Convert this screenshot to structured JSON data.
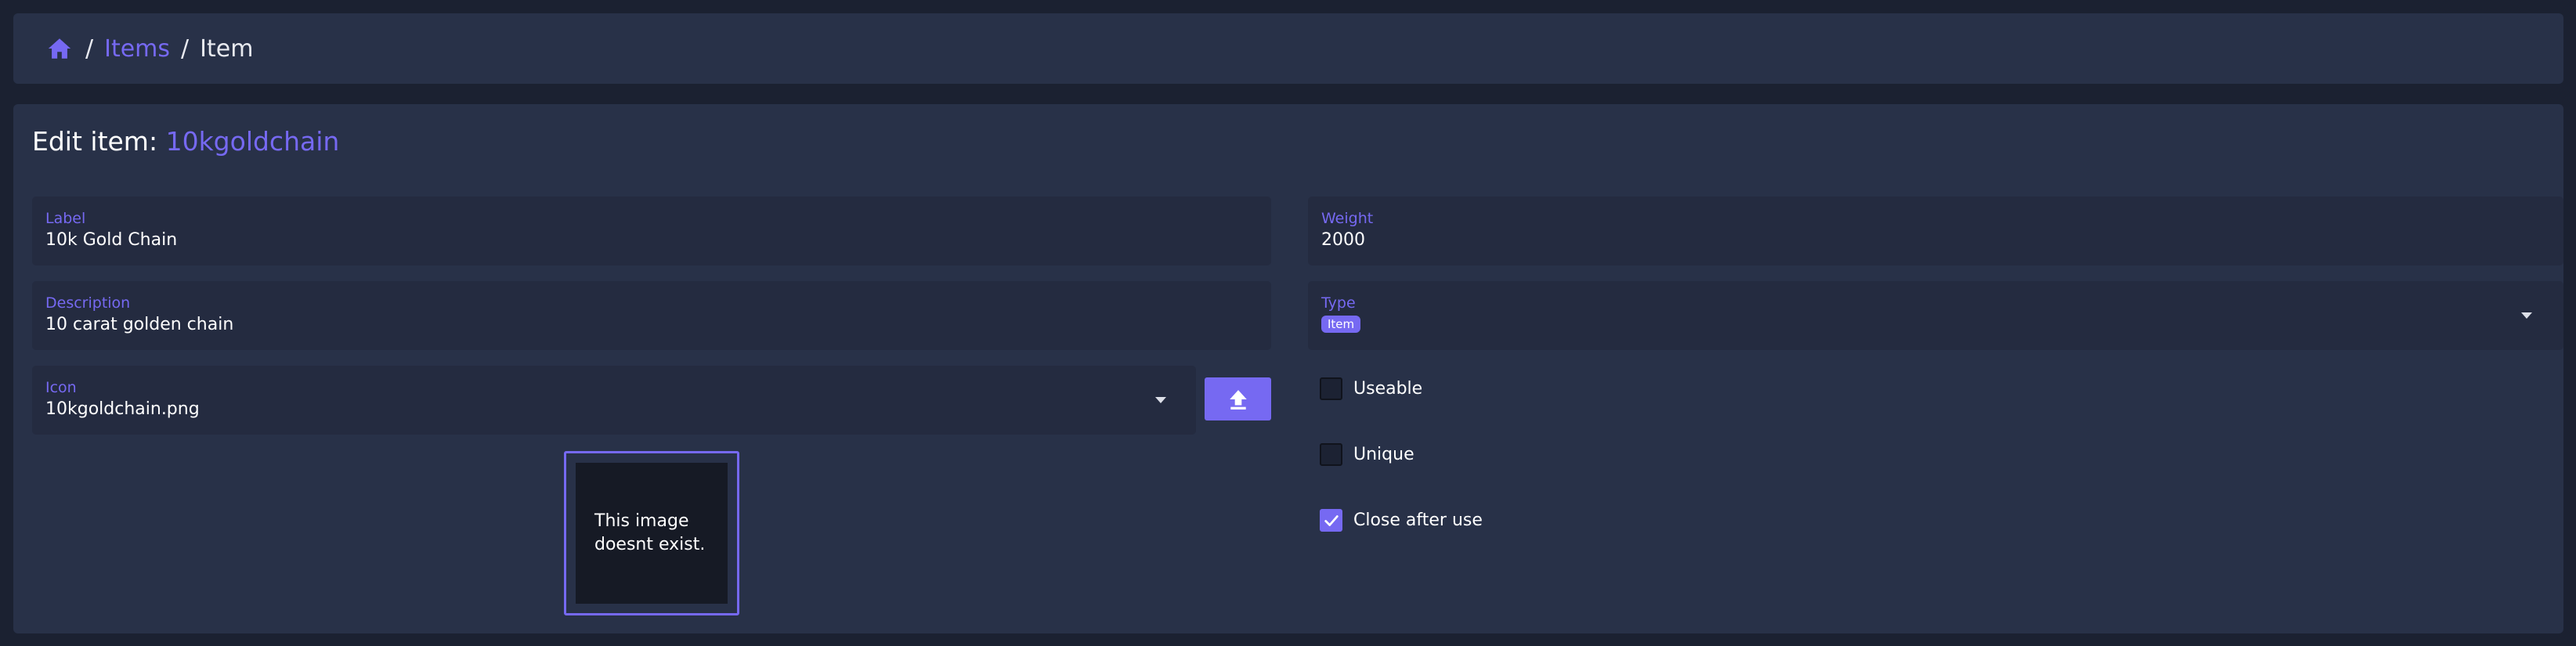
{
  "breadcrumb": {
    "home_icon": "home-icon",
    "separator": "/",
    "items_label": "Items",
    "current_label": "Item"
  },
  "editor": {
    "title_prefix": "Edit item:",
    "item_id": "10kgoldchain"
  },
  "fields": {
    "label": {
      "label": "Label",
      "value": "10k Gold Chain"
    },
    "description": {
      "label": "Description",
      "value": "10 carat golden chain"
    },
    "icon": {
      "label": "Icon",
      "value": "10kgoldchain.png"
    },
    "weight": {
      "label": "Weight",
      "value": "2000"
    },
    "type": {
      "label": "Type",
      "value": "Item"
    }
  },
  "upload_button": {
    "icon": "upload-icon"
  },
  "image_preview": {
    "message": "This image doesnt exist."
  },
  "options": [
    {
      "label": "Useable",
      "checked": false
    },
    {
      "label": "Unique",
      "checked": false
    },
    {
      "label": "Close after use",
      "checked": true
    }
  ],
  "colors": {
    "accent": "#7669f2",
    "background": "#1b2131",
    "card": "#283148",
    "field": "#242b40"
  }
}
